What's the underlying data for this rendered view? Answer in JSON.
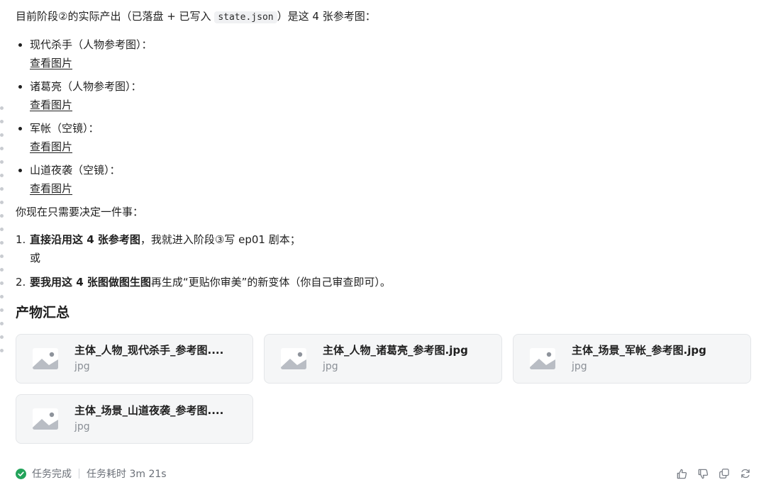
{
  "message": {
    "intro_prefix": "目前阶段②的实际产出（已落盘 + 已写入 ",
    "intro_code": "state.json",
    "intro_suffix": "）是这 4 张参考图：",
    "references": [
      {
        "label": "现代杀手（人物参考图）：",
        "link": "查看图片"
      },
      {
        "label": "诸葛亮（人物参考图）：",
        "link": "查看图片"
      },
      {
        "label": "军帐（空镜）：",
        "link": "查看图片"
      },
      {
        "label": "山道夜袭（空镜）：",
        "link": "查看图片"
      }
    ],
    "decision_text": "你现在只需要决定一件事：",
    "options": [
      {
        "num": "1.",
        "bold": "直接沿用这 4 张参考图",
        "rest": "，我就进入阶段③写 ep01 剧本；",
        "extra": "或"
      },
      {
        "num": "2.",
        "bold": "要我用这 4 张图做图生图",
        "rest": "再生成“更贴你审美”的新变体（你自己审查即可）。"
      }
    ]
  },
  "artifacts": {
    "title": "产物汇总",
    "files": [
      {
        "name": "主体_人物_现代杀手_参考图....",
        "ext": "jpg"
      },
      {
        "name": "主体_人物_诸葛亮_参考图.jpg",
        "ext": "jpg"
      },
      {
        "name": "主体_场景_军帐_参考图.jpg",
        "ext": "jpg"
      },
      {
        "name": "主体_场景_山道夜袭_参考图....",
        "ext": "jpg"
      }
    ]
  },
  "footer": {
    "status": "任务完成",
    "duration": "任务耗时 3m 21s",
    "status_color": "#22a35a"
  },
  "icons": [
    "check-circle-icon",
    "image-file-icon",
    "thumbs-up-icon",
    "thumbs-down-icon",
    "copy-icon",
    "regenerate-icon"
  ]
}
